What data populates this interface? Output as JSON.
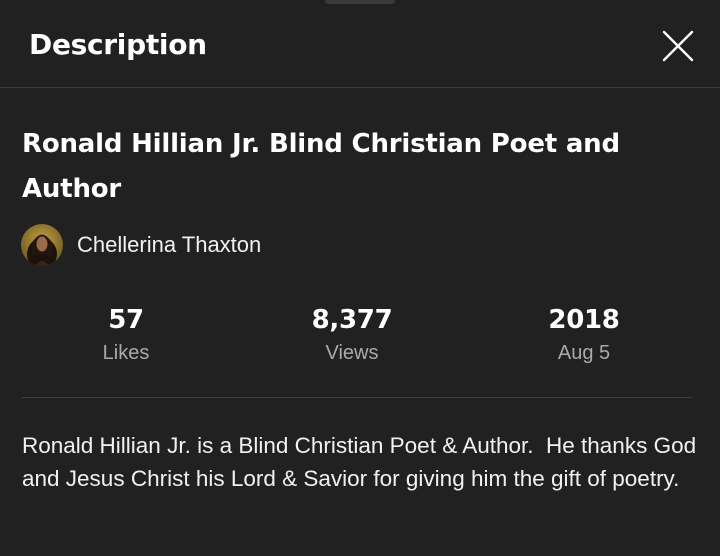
{
  "panel": {
    "title": "Description",
    "close_icon": "close-icon"
  },
  "video": {
    "title": "Ronald Hillian Jr. Blind Christian Poet and Author",
    "channel": {
      "name": "Chellerina Thaxton",
      "avatar_icon": "avatar"
    },
    "stats": {
      "likes_value": "57",
      "likes_label": "Likes",
      "views_value": "8,377",
      "views_label": "Views",
      "year_value": "2018",
      "date_label": "Aug 5"
    },
    "description": "Ronald Hillian Jr. is a Blind Christian Poet & Author.  He thanks God and Jesus Christ his Lord & Savior for giving him the gift of poetry."
  },
  "colors": {
    "background": "#212121",
    "text": "#ffffff",
    "secondary_text": "#aaaaaa",
    "divider": "#3d3d3d"
  }
}
